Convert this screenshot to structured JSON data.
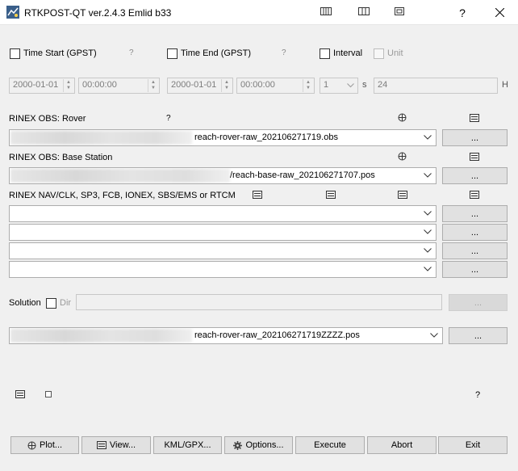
{
  "window": {
    "title": "RTKPOST-QT ver.2.4.3 Emlid b33",
    "help_label": "?",
    "close_label": "X"
  },
  "time": {
    "time_start_label": "Time Start (GPST)",
    "time_start_help": "?",
    "time_end_label": "Time End (GPST)",
    "time_end_help": "?",
    "interval_label": "Interval",
    "unit_label": "Unit",
    "start_date": "2000-01-01",
    "start_time": "00:00:00",
    "end_date": "2000-01-01",
    "end_time": "00:00:00",
    "interval_value": "1",
    "interval_unit": "s",
    "unit_value": "24",
    "unit_suffix": "H"
  },
  "inputs": {
    "rover_label": "RINEX OBS: Rover",
    "rover_help": "?",
    "rover_file": "reach-rover-raw_202106271719.obs",
    "base_label": "RINEX OBS: Base Station",
    "base_file": "/reach-base-raw_202106271707.pos",
    "nav_label": "RINEX NAV/CLK, SP3, FCB, IONEX, SBS/EMS  or RTCM",
    "nav_files": [
      "",
      "",
      "",
      ""
    ],
    "browse_label": "..."
  },
  "solution": {
    "label": "Solution",
    "dir_label": "Dir",
    "dir_value": "",
    "output_file": "reach-rover-raw_202106271719ZZZZ.pos",
    "browse_label": "...",
    "help": "?"
  },
  "buttons": {
    "plot": "Plot...",
    "view": "View...",
    "kml": "KML/GPX...",
    "options": "Options...",
    "execute": "Execute",
    "abort": "Abort",
    "exit": "Exit"
  },
  "colors": {
    "background": "#f0f0f0",
    "border": "#adadad",
    "button": "#e1e1e1"
  }
}
